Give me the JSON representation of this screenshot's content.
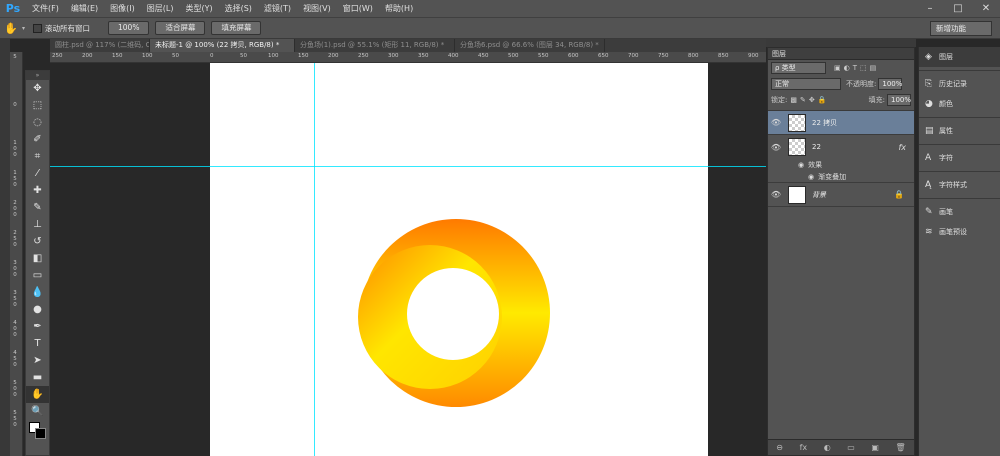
{
  "app": {
    "logo": "Ps"
  },
  "menu": [
    "文件(F)",
    "编辑(E)",
    "图像(I)",
    "图层(L)",
    "类型(Y)",
    "选择(S)",
    "滤镜(T)",
    "视图(V)",
    "窗口(W)",
    "帮助(H)"
  ],
  "window_controls": {
    "minimize": "–",
    "maximize": "□",
    "close": "✕"
  },
  "options": {
    "scroll_all_label": "滚动所有窗口",
    "zoom_100": "100%",
    "fit_screen": "适合屏幕",
    "fill_screen": "填充屏幕",
    "workspace": "新增功能"
  },
  "tabs": [
    "圆柱.psd @ 117% (二维码, CMYK/8) *",
    "未标题-1 @ 100% (22 拷贝, RGB/8) *",
    "分鱼场(1).psd @ 55.1% (矩形 11, RGB/8) *",
    "分鱼场6.psd @ 66.6% (图层 34, RGB/8) *"
  ],
  "ruler_h": [
    "250",
    "200",
    "150",
    "100",
    "50",
    "0",
    "50",
    "100",
    "150",
    "200",
    "250",
    "300",
    "350",
    "400",
    "450",
    "500",
    "550",
    "600",
    "650",
    "700",
    "750",
    "800",
    "850",
    "900"
  ],
  "ruler_v": [
    "5",
    "0",
    "1\n0\n0",
    "1\n5\n0",
    "2\n0\n0",
    "2\n5\n0",
    "3\n0\n0",
    "3\n5\n0",
    "4\n0\n0",
    "4\n5\n0",
    "5\n0\n0",
    "5\n5\n0"
  ],
  "tools": [
    "move",
    "marquee",
    "lasso",
    "quick-select",
    "crop",
    "eyedropper",
    "healing",
    "brush",
    "stamp",
    "history-brush",
    "eraser",
    "gradient",
    "blur",
    "dodge",
    "pen",
    "type",
    "path-select",
    "shape",
    "hand",
    "zoom"
  ],
  "colors": {
    "accent": "#31a8ff",
    "guide": "#00e5ff",
    "ring_light": "#ffea00",
    "ring_dark": "#ff7a00",
    "layer_selected": "#6a7f99"
  },
  "layers_panel": {
    "title": "图层",
    "filter_label": "ρ 类型",
    "blend_mode": "正常",
    "opacity_label": "不透明度:",
    "opacity_value": "100%",
    "lock_label": "锁定:",
    "fill_label": "填充:",
    "fill_value": "100%",
    "layers": [
      {
        "name": "22 拷贝",
        "selected": true
      },
      {
        "name": "22",
        "fx": "fx",
        "effects_label": "效果",
        "effect": "渐变叠加"
      },
      {
        "name": "背景"
      }
    ],
    "footer": [
      "⊖",
      "fx",
      "◐",
      "▭",
      "▣",
      "🗑"
    ]
  },
  "dock": {
    "items": [
      {
        "icon": "layers-icon",
        "glyph": "◈",
        "label": "图层",
        "active": true
      },
      {
        "icon": "history-icon",
        "glyph": "⎘",
        "label": "历史记录"
      },
      {
        "icon": "color-icon",
        "glyph": "◕",
        "label": "颜色"
      },
      {
        "icon": "properties-icon",
        "glyph": "▤",
        "label": "属性"
      },
      {
        "icon": "character-icon",
        "glyph": "A",
        "label": "字符"
      },
      {
        "icon": "char-style-icon",
        "glyph": "Ą",
        "label": "字符样式"
      },
      {
        "icon": "brush-icon",
        "glyph": "✎",
        "label": "画笔"
      },
      {
        "icon": "brush-preset-icon",
        "glyph": "≋",
        "label": "画笔预设"
      }
    ]
  }
}
